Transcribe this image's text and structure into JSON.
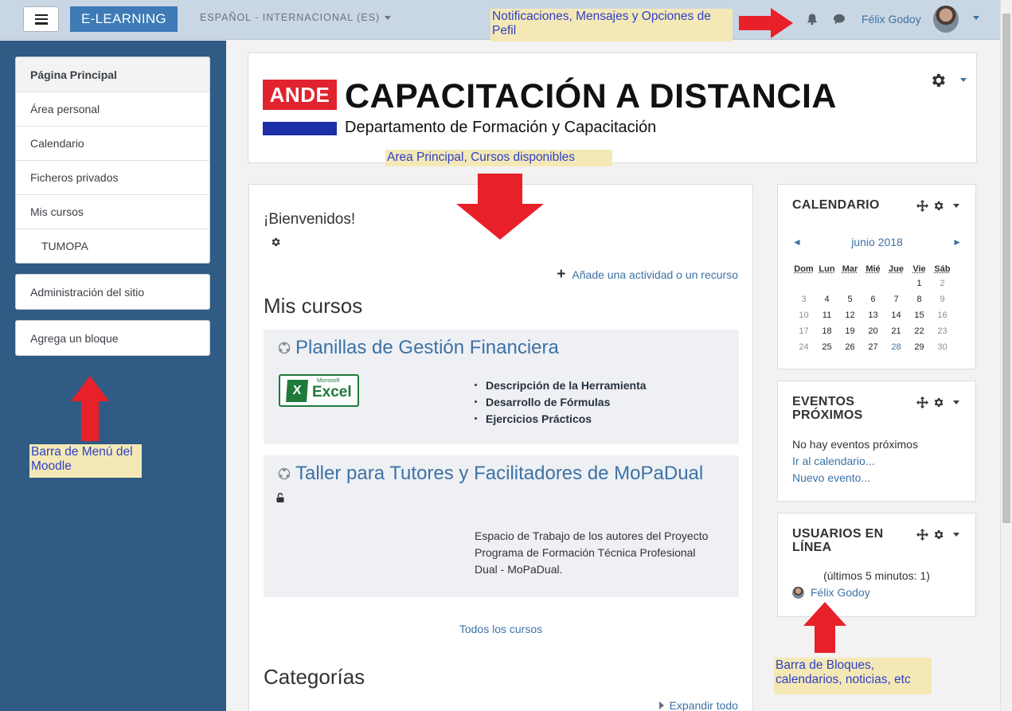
{
  "navbar": {
    "brand": "E-LEARNING",
    "language": "ESPAÑOL - INTERNACIONAL (ES)",
    "user_name": "Félix Godoy"
  },
  "annotations": {
    "top": "Notificaciones, Mensajes y Opciones de Pefil",
    "main": "Area Principal, Cursos disponibles",
    "left": "Barra de Menú del Moodle",
    "right": "Barra de Bloques, calendarios, noticias, etc",
    "arrow_color": "#e8202a"
  },
  "drawer": {
    "nav_items": [
      {
        "label": "Página Principal"
      },
      {
        "label": "Área personal"
      },
      {
        "label": "Calendario"
      },
      {
        "label": "Ficheros privados"
      },
      {
        "label": "Mis cursos"
      },
      {
        "label": "TUMOPA"
      }
    ],
    "admin": "Administración del sitio",
    "add_block": "Agrega un bloque"
  },
  "header": {
    "logo_mark": "ANDE",
    "title": "CAPACITACIÓN A DISTANCIA",
    "subtitle": "Departamento de Formación y Capacitación"
  },
  "main": {
    "welcome": "¡Bienvenidos!",
    "add_activity": "Añade una actividad o un recurso",
    "my_courses_heading": "Mis cursos",
    "courses": [
      {
        "title": "Planillas de Gestión Financiera",
        "logo_small": "Microsoft",
        "logo_word": "Excel",
        "logo_letter": "X",
        "bullets": [
          "Descripción de la Herramienta",
          "Desarrollo de Fórmulas",
          "Ejercicios Prácticos"
        ]
      },
      {
        "title": "Taller para Tutores y Facilitadores de MoPaDual",
        "description": "Espacio de Trabajo de los autores del Proyecto Programa de Formación Técnica Profesional Dual - MoPaDual."
      }
    ],
    "all_courses": "Todos los cursos",
    "categories_heading": "Categorías",
    "expand_all": "Expandir todo"
  },
  "blocks": {
    "calendar": {
      "title": "CALENDARIO",
      "month": "junio 2018",
      "prev": "◄",
      "next": "►",
      "weekdays": [
        "Dom",
        "Lun",
        "Mar",
        "Mié",
        "Jue",
        "Vie",
        "Sáb"
      ],
      "weeks": [
        [
          "",
          "",
          "",
          "",
          "",
          "1",
          "2"
        ],
        [
          "3",
          "4",
          "5",
          "6",
          "7",
          "8",
          "9"
        ],
        [
          "10",
          "11",
          "12",
          "13",
          "14",
          "15",
          "16"
        ],
        [
          "17",
          "18",
          "19",
          "20",
          "21",
          "22",
          "23"
        ],
        [
          "24",
          "25",
          "26",
          "27",
          "28",
          "29",
          "30"
        ]
      ],
      "today": "28"
    },
    "events": {
      "title": "EVENTOS PRÓXIMOS",
      "empty": "No hay eventos próximos",
      "go_calendar": "Ir al calendario...",
      "new_event": "Nuevo evento..."
    },
    "online": {
      "title": "USUARIOS EN LÍNEA",
      "subtitle": "(últimos 5 minutos: 1)",
      "user": "Félix Godoy"
    }
  }
}
